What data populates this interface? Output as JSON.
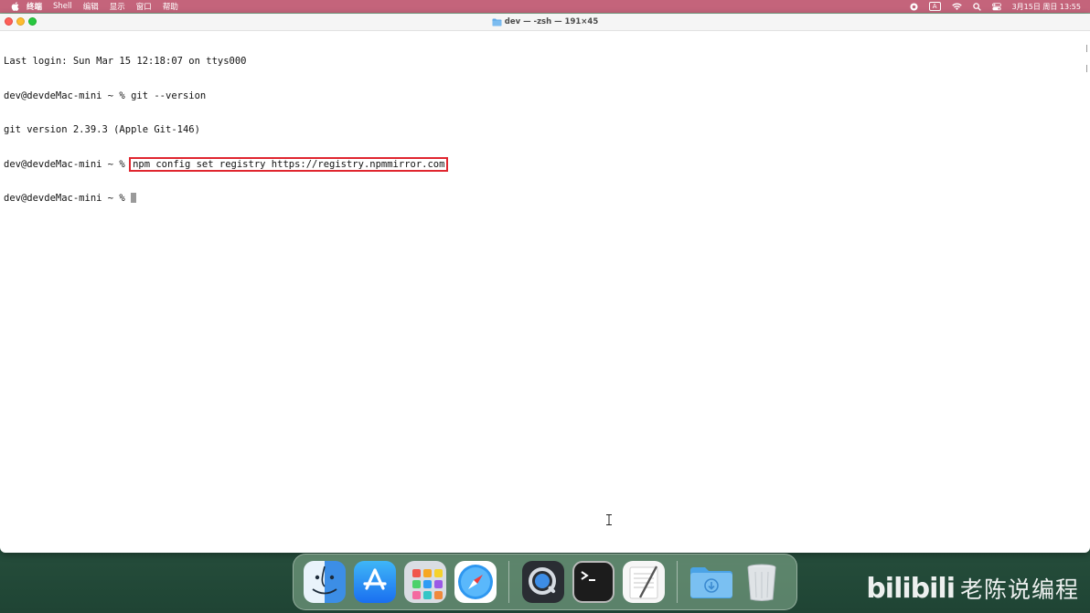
{
  "menubar": {
    "app_menus": [
      "终端",
      "Shell",
      "编辑",
      "显示",
      "窗口",
      "帮助"
    ],
    "ime_label": "A",
    "clock": "3月15日 周日 13:55"
  },
  "window": {
    "title": "dev — -zsh — 191×45"
  },
  "terminal": {
    "lines": [
      "Last login: Sun Mar 15 12:18:07 on ttys000",
      "dev@devdeMac-mini ~ % git --version",
      "git version 2.39.3 (Apple Git-146)"
    ],
    "prompt": "dev@devdeMac-mini ~ % ",
    "highlighted_command": "npm config set registry https://registry.npmmirror.com",
    "final_prompt": "dev@devdeMac-mini ~ % ",
    "highlight_color": "#e0262f"
  },
  "dock": {
    "apps": [
      "finder-icon",
      "app-store-icon",
      "launchpad-icon",
      "safari-icon",
      "quicktime-icon",
      "terminal-icon",
      "textedit-icon",
      "downloads-folder-icon",
      "trash-icon"
    ]
  },
  "watermark": {
    "brand": "bilibili",
    "text": "老陈说编程"
  }
}
